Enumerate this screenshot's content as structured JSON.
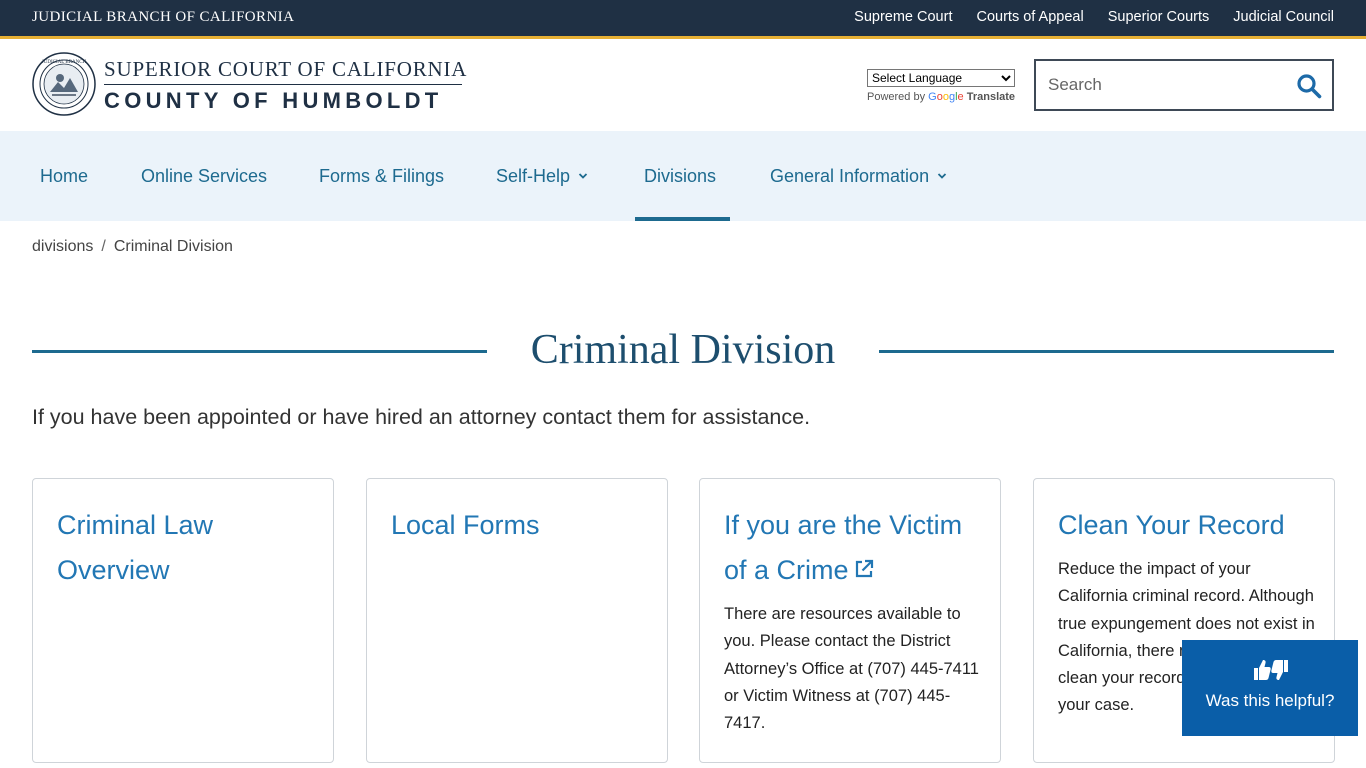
{
  "topbar": {
    "branch": "JUDICIAL BRANCH OF CALIFORNIA",
    "links": [
      "Supreme Court",
      "Courts of Appeal",
      "Superior Courts",
      "Judicial Council"
    ]
  },
  "header": {
    "court_line1": "SUPERIOR COURT OF CALIFORNIA",
    "court_line2": "COUNTY OF HUMBOLDT",
    "seal_icon": "california-judicial-seal",
    "language_select": "Select Language",
    "powered_by": "Powered by",
    "google": "Google",
    "translate": "Translate",
    "search_placeholder": "Search",
    "search_icon": "search-icon"
  },
  "nav": {
    "items": [
      {
        "label": "Home"
      },
      {
        "label": "Online Services"
      },
      {
        "label": "Forms & Filings"
      },
      {
        "label": "Self-Help"
      },
      {
        "label": "Divisions"
      },
      {
        "label": "General Information"
      }
    ],
    "active": "Divisions"
  },
  "breadcrumb": {
    "items": [
      "divisions",
      "Criminal Division"
    ],
    "separator": "/"
  },
  "page": {
    "title": "Criminal Division",
    "intro": "If you have been appointed or have hired an attorney contact them for assistance."
  },
  "cards": [
    {
      "title": "Criminal Law Overview",
      "body": ""
    },
    {
      "title": "Local Forms",
      "body": ""
    },
    {
      "title": "If you are the Victim of a Crime",
      "body": "There are resources available to you. Please contact the District Attorney’s Office at (707) 445-7411 or Victim Witness at (707) 445-7417.",
      "external": true
    },
    {
      "title": "Clean Your Record",
      "body": "Reduce the impact of your California criminal record. Although true expungement does not exist in California, there may be options to clean your record depending on your case."
    }
  ],
  "helpful": {
    "label": "Was this helpful?",
    "icon": "thumbs-up-down-icon"
  },
  "colors": {
    "topbar": "#1f3044",
    "gold": "#e7b034",
    "nav_bg": "#ebf3fa",
    "link": "#2277b4",
    "accent": "#1d6a8f",
    "helpful_bg": "#0a5ea8"
  }
}
